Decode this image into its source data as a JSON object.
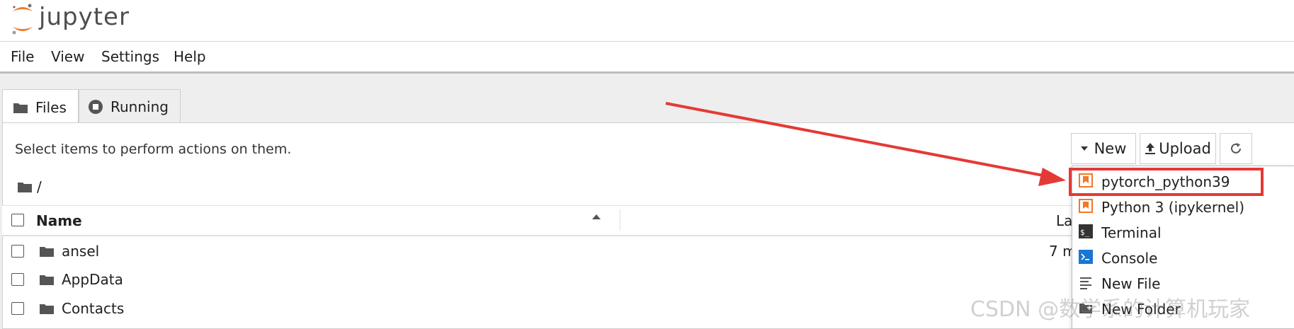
{
  "header": {
    "brand": "jupyter"
  },
  "menubar": {
    "items": [
      "File",
      "View",
      "Settings",
      "Help"
    ]
  },
  "tabs": [
    {
      "label": "Files",
      "icon": "folder-icon",
      "active": true
    },
    {
      "label": "Running",
      "icon": "stop-circle-icon",
      "active": false
    }
  ],
  "toolbar": {
    "hint": "Select items to perform actions on them.",
    "new_label": "New",
    "upload_label": "Upload",
    "refresh_icon": "refresh-icon"
  },
  "breadcrumb": {
    "path": "/"
  },
  "list": {
    "col_name": "Name",
    "col_modified": "La",
    "rows": [
      {
        "name": "ansel",
        "modified": "7 m"
      },
      {
        "name": "AppData",
        "modified": ""
      },
      {
        "name": "Contacts",
        "modified": ""
      }
    ]
  },
  "dropdown": {
    "items": [
      {
        "label": "pytorch_python39",
        "icon": "notebook-kernel-icon"
      },
      {
        "label": "Python 3 (ipykernel)",
        "icon": "notebook-kernel-icon"
      },
      {
        "label": "Terminal",
        "icon": "terminal-icon"
      },
      {
        "label": "Console",
        "icon": "console-icon"
      },
      {
        "label": "New File",
        "icon": "text-file-icon"
      },
      {
        "label": "New Folder",
        "icon": "new-folder-icon"
      }
    ]
  },
  "watermark": "CSDN @数学系的计算机玩家",
  "colors": {
    "accent_orange": "#f37726",
    "annotation_red": "#e53935",
    "console_blue": "#1976d2"
  }
}
